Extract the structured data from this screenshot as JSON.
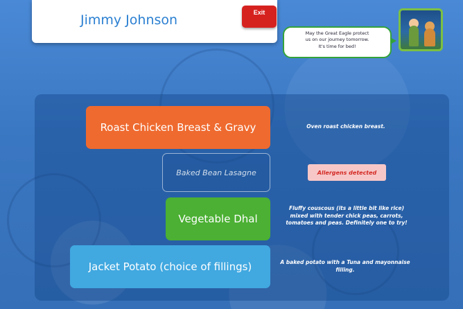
{
  "user": {
    "name": "Jimmy Johnson"
  },
  "header": {
    "exit_label": "Exit"
  },
  "speech": {
    "lines": [
      "May the Great Eagle protect",
      "us on our journey tomorrow.",
      "It's time for bed!"
    ],
    "avatar_icon": "character-portrait-icon"
  },
  "menu": {
    "items": [
      {
        "label": "Roast Chicken Breast & Gravy",
        "description": "Oven roast chicken breast.",
        "color": "#ef6a2f",
        "available": true
      },
      {
        "label": "Baked Bean Lasagne",
        "status": "Allergens detected",
        "available": false
      },
      {
        "label": "Vegetable Dhal",
        "description": "Fluffy couscous (its a little bit like rice) mixed with tender chick peas, carrots, tomatoes and peas. Definitely one to try!",
        "color": "#4bb033",
        "available": true
      },
      {
        "label": "Jacket Potato (choice of fillings)",
        "description": "A baked potato with a Tuna and mayonnaise filling.",
        "color": "#41a8e0",
        "available": true
      }
    ]
  },
  "colors": {
    "background": "#3a78c2",
    "exit": "#d6221f",
    "allergen_bg": "#f7c7c7",
    "allergen_text": "#d42a25",
    "bubble_border": "#33a33a"
  }
}
